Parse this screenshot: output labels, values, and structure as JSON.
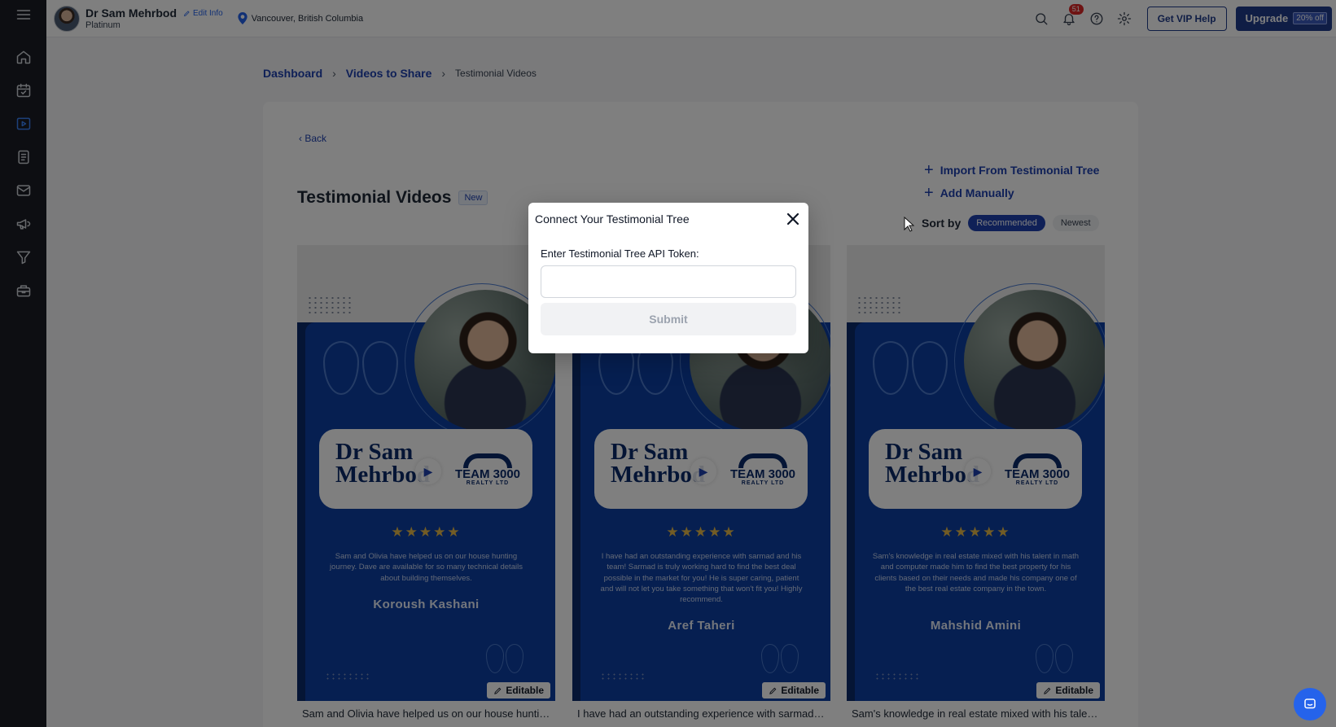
{
  "user": {
    "name": "Dr Sam Mehrbod",
    "edit_label": "Edit Info",
    "tier": "Platinum",
    "location": "Vancouver, British Columbia"
  },
  "topbar": {
    "notification_count": "51",
    "vip_label": "Get VIP Help",
    "upgrade_label": "Upgrade",
    "upgrade_badge": "20% off"
  },
  "breadcrumb": {
    "items": [
      "Dashboard",
      "Videos to Share",
      "Testimonial Videos"
    ]
  },
  "page": {
    "back_label": "Back",
    "title": "Testimonial Videos",
    "title_badge": "New",
    "import_label": "Import From Testimonial Tree",
    "add_label": "Add Manually",
    "sort_label": "Sort by",
    "sort_options": [
      "Recommended",
      "Newest"
    ]
  },
  "videos": [
    {
      "agent_line1": "Dr Sam",
      "agent_line2": "Mehrbod",
      "logo_team": "TEAM 3000",
      "logo_realty": "REALTY LTD",
      "stars": "★★★★★",
      "quote": "Sam and Olivia have helped us on our house hunting journey. Dave are available for so many technical details about building themselves.",
      "reviewer": "Koroush Kashani",
      "editable_label": "Editable",
      "caption": "Sam and Olivia have helped us on our house hunting journey. Dave are available for so many technical details"
    },
    {
      "agent_line1": "Dr Sam",
      "agent_line2": "Mehrbod",
      "logo_team": "TEAM 3000",
      "logo_realty": "REALTY LTD",
      "stars": "★★★★★",
      "quote": "I have had an outstanding experience with sarmad and his team! Sarmad is truly working hard to find the best deal possible in the market for you! He is super caring, patient and will not let you take something that won't fit you! Highly recommend.",
      "reviewer": "Aref Taheri",
      "editable_label": "Editable",
      "caption": "I have had an outstanding experience with sarmad and his team! Sarmad is truly working hard"
    },
    {
      "agent_line1": "Dr Sam",
      "agent_line2": "Mehrbod",
      "logo_team": "TEAM 3000",
      "logo_realty": "REALTY LTD",
      "stars": "★★★★★",
      "quote": "Sam's knowledge in real estate mixed with his talent in math and computer made him to find the best property for his clients based on their needs and made his company one of the best real estate company in the town.",
      "reviewer": "Mahshid Amini",
      "editable_label": "Editable",
      "caption": "Sam's knowledge in real estate mixed with his talent in math and computer made him"
    }
  ],
  "modal": {
    "title": "Connect Your Testimonial Tree",
    "field_label": "Enter Testimonial Tree API Token:",
    "field_value": "",
    "submit_label": "Submit"
  },
  "colors": {
    "brand": "#1e3a8a",
    "accent": "#2563eb",
    "sidebar_bg": "#1a1d24"
  }
}
